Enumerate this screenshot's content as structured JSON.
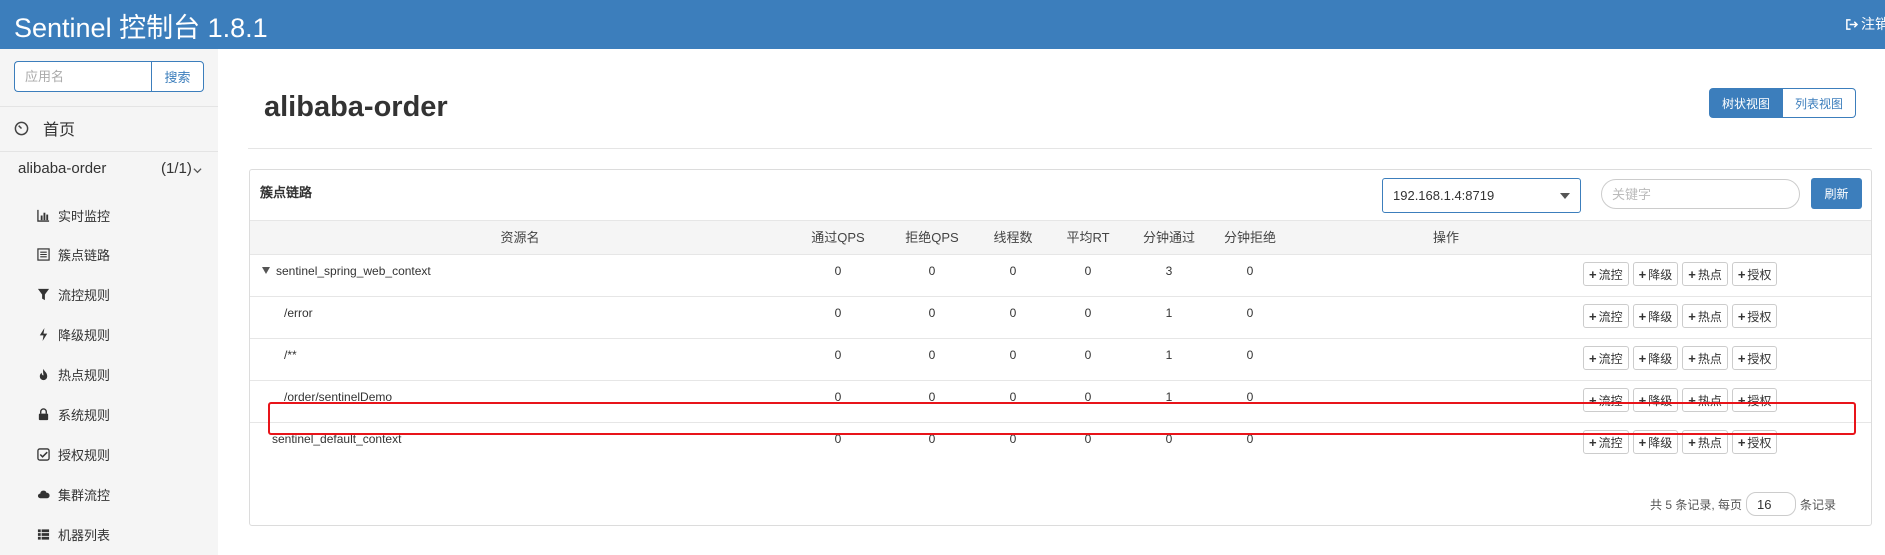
{
  "header": {
    "title": "Sentinel 控制台 1.8.1",
    "logout_label": "注销"
  },
  "sidebar": {
    "search_placeholder": "应用名",
    "search_button": "搜索",
    "home_label": "首页",
    "app": {
      "name": "alibaba-order",
      "count": "(1/1)"
    },
    "menu": [
      {
        "label": "实时监控",
        "icon": "bar-chart-icon"
      },
      {
        "label": "簇点链路",
        "icon": "list-icon"
      },
      {
        "label": "流控规则",
        "icon": "filter-icon"
      },
      {
        "label": "降级规则",
        "icon": "flash-icon"
      },
      {
        "label": "热点规则",
        "icon": "fire-icon"
      },
      {
        "label": "系统规则",
        "icon": "lock-icon"
      },
      {
        "label": "授权规则",
        "icon": "check-square-icon"
      },
      {
        "label": "集群流控",
        "icon": "cloud-icon"
      },
      {
        "label": "机器列表",
        "icon": "th-list-icon"
      }
    ]
  },
  "main": {
    "page_title": "alibaba-order",
    "view_tree": "树状视图",
    "view_list": "列表视图",
    "panel_title": "簇点链路",
    "machine": "192.168.1.4:8719",
    "keyword_placeholder": "关键字",
    "refresh": "刷新",
    "columns": [
      "资源名",
      "通过QPS",
      "拒绝QPS",
      "线程数",
      "平均RT",
      "分钟通过",
      "分钟拒绝",
      "操作"
    ],
    "rows": [
      {
        "resource": "sentinel_spring_web_context",
        "pass_qps": "0",
        "block_qps": "0",
        "threads": "0",
        "avg_rt": "0",
        "min_pass": "3",
        "min_block": "0"
      },
      {
        "resource": "/error",
        "pass_qps": "0",
        "block_qps": "0",
        "threads": "0",
        "avg_rt": "0",
        "min_pass": "1",
        "min_block": "0"
      },
      {
        "resource": "/**",
        "pass_qps": "0",
        "block_qps": "0",
        "threads": "0",
        "avg_rt": "0",
        "min_pass": "1",
        "min_block": "0"
      },
      {
        "resource": "/order/sentinelDemo",
        "pass_qps": "0",
        "block_qps": "0",
        "threads": "0",
        "avg_rt": "0",
        "min_pass": "1",
        "min_block": "0"
      },
      {
        "resource": "sentinel_default_context",
        "pass_qps": "0",
        "block_qps": "0",
        "threads": "0",
        "avg_rt": "0",
        "min_pass": "0",
        "min_block": "0"
      }
    ],
    "ops": {
      "flow": "流控",
      "degrade": "降级",
      "hot": "热点",
      "auth": "授权"
    },
    "pager": {
      "prefix": "共 5 条记录, 每页",
      "page_size": "16",
      "suffix": "条记录"
    }
  },
  "colors": {
    "primary": "#3c7ebc",
    "highlight": "#e8141a"
  }
}
